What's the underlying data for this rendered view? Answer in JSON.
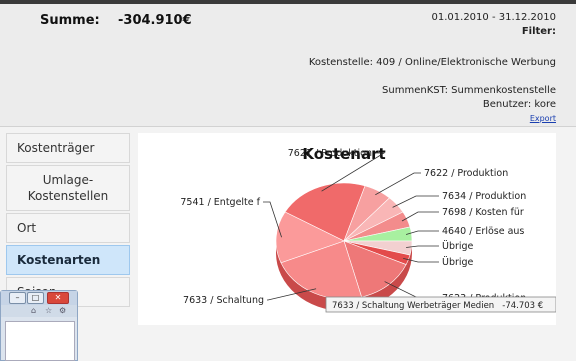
{
  "header": {
    "summe_label": "Summe:",
    "summe_value": "-304.910€",
    "date_range": "01.01.2010 - 31.12.2010",
    "filter_label": "Filter:",
    "kostenstelle": "Kostenstelle: 409 / Online/Elektronische Werbung",
    "summenkst": "SummenKST: Summenkostenstelle",
    "benutzer": "Benutzer: kore",
    "export_label": "Export"
  },
  "sidebar": {
    "items": [
      {
        "label": "Kostenträger"
      },
      {
        "label": "Umlage-\nKostenstellen"
      },
      {
        "label": "Ort"
      },
      {
        "label": "Kostenarten"
      },
      {
        "label": "Saison"
      }
    ]
  },
  "chart_data": {
    "type": "pie",
    "title": "Kostenart",
    "slices": [
      {
        "label": "7621 / Produktion",
        "color": "#f06a6a"
      },
      {
        "label": "7622 / Produktion",
        "color": "#f7a0a0"
      },
      {
        "label": "7634 / Produktion",
        "color": "#f9b6b6"
      },
      {
        "label": "7698 / Kosten für",
        "color": "#f38c8c"
      },
      {
        "label": "4640 / Erlöse aus",
        "color": "#a8f0a0"
      },
      {
        "label": "Übrige",
        "color": "#f2d0d0"
      },
      {
        "label": "Übrige",
        "color": "#e34b4b"
      },
      {
        "label": "7623 / Produktion",
        "color": "#ee7878"
      },
      {
        "label": "7633 / Schaltung",
        "color": "#f78a8a"
      },
      {
        "label": "7541 / Entgelte f",
        "color": "#fb9a9a"
      }
    ],
    "tooltip": "7633 / Schaltung Werbeträger Medien   -74.703 €"
  },
  "window": {
    "min_label": "–",
    "max_label": "□",
    "close_label": "✕",
    "icons": [
      "home-icon",
      "star-icon",
      "gear-icon"
    ]
  }
}
